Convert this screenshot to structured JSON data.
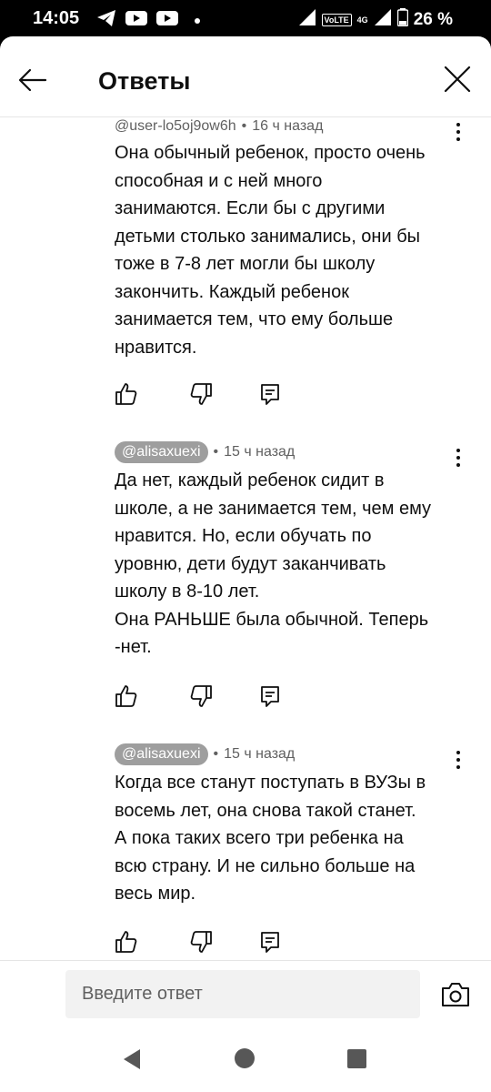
{
  "status_bar": {
    "time": "14:05",
    "notification_icons": [
      "telegram-icon",
      "youtube-icon",
      "youtube-icon",
      "dot-icon"
    ],
    "network_label": "VoLTE",
    "network_gen": "4G",
    "battery": "26 %"
  },
  "header": {
    "title": "Ответы",
    "back_icon": "arrow-left-icon",
    "close_icon": "close-icon"
  },
  "comments": [
    {
      "author": "@user-lo5oj9ow6h",
      "highlighted": false,
      "time": "16 ч назад",
      "text": "Она обычный ребенок, просто очень\nспособная и с ней много\nзанимаются. Если бы с другими\nдетьми столько занимались, они бы\nтоже в 7-8 лет могли бы школу\nзакончить. Каждый ребенок\nзанимается тем, что ему больше\nнравится."
    },
    {
      "author": "@alisaxuexi",
      "highlighted": true,
      "time": "15 ч назад",
      "text": "Да нет, каждый ребенок сидит в\nшколе, а не занимается тем, чем ему\nнравится.  Но, если обучать по\nуровню, дети будут заканчивать\nшколу в 8-10 лет.\nОна РАНЬШЕ была обычной. Теперь\n-нет."
    },
    {
      "author": "@alisaxuexi",
      "highlighted": true,
      "time": "15 ч назад",
      "text": "Когда все станут поступать в ВУЗы в\nвосемь лет, она снова такой станет.\nА пока таких всего три ребенка на\nвсю страну. И не сильно больше на\nвесь мир."
    }
  ],
  "separator": "•",
  "composer": {
    "placeholder": "Введите ответ",
    "camera_icon": "camera-icon"
  },
  "nav_bar": {
    "buttons": [
      "back-triangle-icon",
      "home-circle-icon",
      "recents-square-icon"
    ]
  },
  "colors": {
    "background": "#ffffff",
    "text": "#0f0f0f",
    "secondary_text": "#606060",
    "author_pill": "#9e9e9e",
    "input_bg": "#f2f2f2"
  }
}
